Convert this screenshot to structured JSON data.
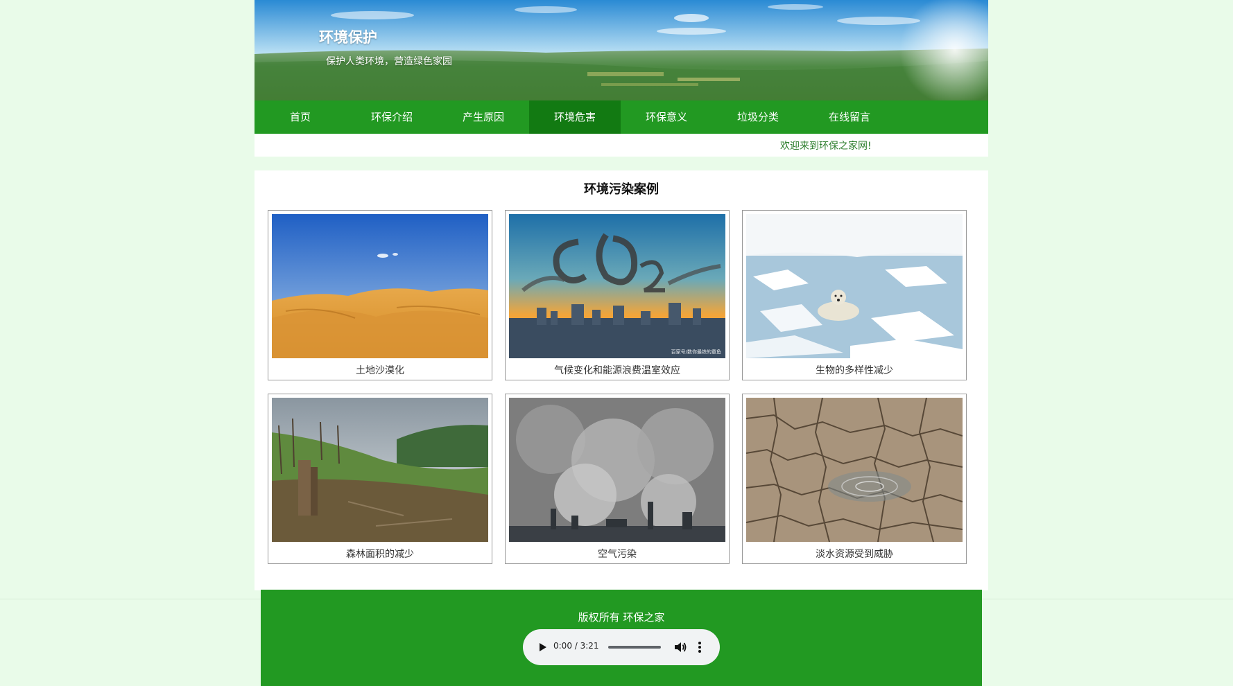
{
  "header": {
    "title": "环境保护",
    "slogan": "保护人类环境，营造绿色家园"
  },
  "nav": {
    "items": [
      {
        "label": "首页"
      },
      {
        "label": "环保介绍"
      },
      {
        "label": "产生原因"
      },
      {
        "label": "环境危害",
        "active": true
      },
      {
        "label": "环保意义"
      },
      {
        "label": "垃圾分类"
      },
      {
        "label": "在线留言"
      }
    ]
  },
  "welcome": "欢迎来到环保之家网!",
  "main": {
    "title": "环境污染案例",
    "cases": [
      {
        "caption": "土地沙漠化",
        "icon": "desert-image"
      },
      {
        "caption": "气候变化和能源浪费温室效应",
        "icon": "co2-smoke-image",
        "watermark": "百家号/数你最铁的童鱼"
      },
      {
        "caption": "生物的多样性减少",
        "icon": "polar-bear-image"
      },
      {
        "caption": "森林面积的减少",
        "icon": "deforestation-image"
      },
      {
        "caption": "空气污染",
        "icon": "factory-smoke-image"
      },
      {
        "caption": "淡水资源受到威胁",
        "icon": "cracked-earth-image"
      }
    ]
  },
  "footer": {
    "copyright": "版权所有 环保之家",
    "audio": {
      "time": "0:00 / 3:21",
      "progress": 0
    }
  },
  "colors": {
    "page_bg": "#e9fbe9",
    "nav_bg": "#229922",
    "nav_active": "#127a12",
    "welcome_text": "#2f7f2f",
    "footer_bg": "#229922"
  }
}
